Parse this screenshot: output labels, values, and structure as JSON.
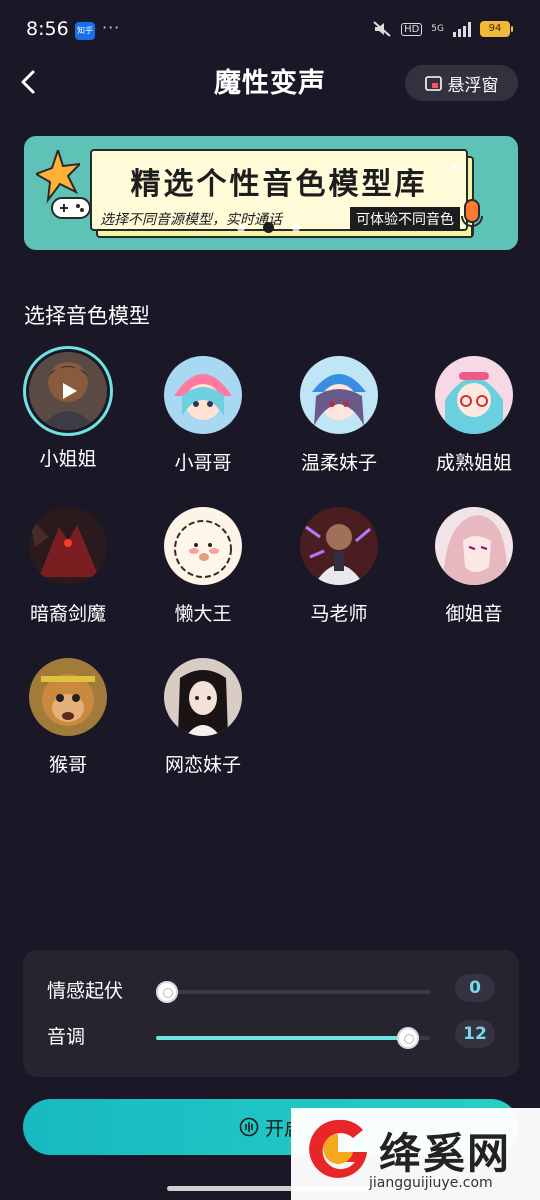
{
  "status_bar": {
    "time": "8:56",
    "app_badge": "知乎",
    "more": "···",
    "hd": "HD",
    "network": "5G",
    "battery": "94"
  },
  "header": {
    "title": "魔性变声",
    "float_window_label": "悬浮窗"
  },
  "banner": {
    "title": "精选个性音色模型库",
    "subtitle": "选择不同音源模型，实时通话",
    "tag": "可体验不同音色",
    "page_count": 3,
    "active_page": 2
  },
  "section_title": "选择音色模型",
  "voices": [
    {
      "label": "小姐姐",
      "selected": true
    },
    {
      "label": "小哥哥",
      "selected": false
    },
    {
      "label": "温柔妹子",
      "selected": false
    },
    {
      "label": "成熟姐姐",
      "selected": false
    },
    {
      "label": "暗裔剑魔",
      "selected": false
    },
    {
      "label": "懒大王",
      "selected": false
    },
    {
      "label": "马老师",
      "selected": false
    },
    {
      "label": "御姐音",
      "selected": false
    },
    {
      "label": "猴哥",
      "selected": false
    },
    {
      "label": "网恋妹子",
      "selected": false
    }
  ],
  "controls": {
    "emotion": {
      "label": "情感起伏",
      "value": "0",
      "fraction": 0.04
    },
    "pitch": {
      "label": "音调",
      "value": "12",
      "fraction": 0.92
    }
  },
  "start_button_label": "开启",
  "accent_color": "#6fe3e0",
  "watermark": {
    "title": "绛奚网",
    "url": "jiangguijiuye.com"
  }
}
